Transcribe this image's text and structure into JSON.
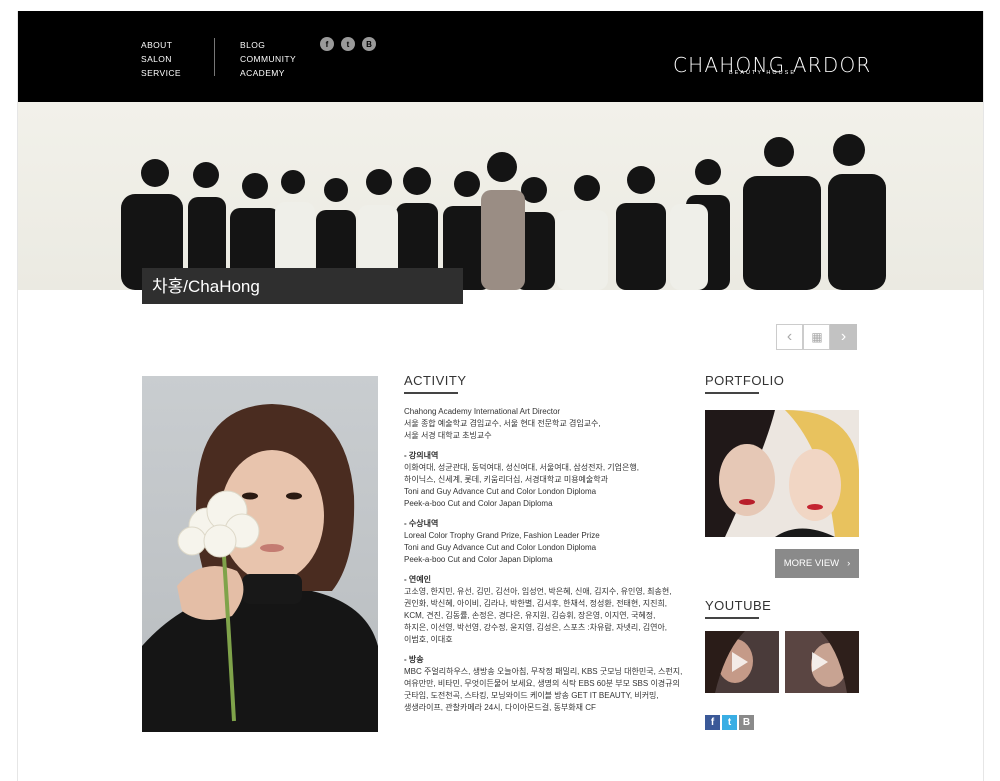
{
  "header": {
    "nav_left": [
      "ABOUT",
      "SALON",
      "SERVICE"
    ],
    "nav_right": [
      "BLOG",
      "COMMUNITY",
      "ACADEMY"
    ],
    "social": [
      {
        "icon": "facebook-icon",
        "glyph": "f"
      },
      {
        "icon": "twitter-icon",
        "glyph": "t"
      },
      {
        "icon": "blog-icon",
        "glyph": "B"
      }
    ],
    "brand": "CHAHONG ARDOR",
    "brand_sub": "BEAUTY HOUSE"
  },
  "banner": {
    "title": "차홍/ChaHong"
  },
  "pager": {
    "prev": "‹",
    "grid": "▦",
    "next": "›"
  },
  "activity": {
    "title": "ACTIVITY",
    "intro": "Chahong Academy International Art Director\n서울 종합 예술학교 겸임교수, 서울 현대 전문학교 겸임교수,\n서울 서경 대학교 초빙교수",
    "sections": [
      {
        "heading": "- 강의내역",
        "body": "이화여대, 성균관대, 동덕여대, 성신여대, 서울여대, 삼성전자, 기업은행,\n하이닉스, 신세계, 롯데, 키움리더십, 서경대학교 미용예술학과\nToni and Guy Advance Cut and Color London Diploma\nPeek-a-boo Cut and Color Japan Diploma"
      },
      {
        "heading": "- 수상내역",
        "body": "Loreal Color Trophy Grand Prize, Fashion Leader Prize\nToni and Guy Advance Cut and Color London Diploma\nPeek-a-boo Cut and Color Japan Diploma"
      },
      {
        "heading": "- 연예인",
        "body": "고소영, 한지민, 유선, 김민, 김선아, 임성언, 박은혜, 신애, 김지수, 유인영, 최송현,\n권인화, 박신혜, 아이비, 김라나, 박한별, 김서후, 한채석, 정성환, 전태현, 지진희,\nKCM, 견진, 김동률, 손정은, 경다은, 유지원, 김승휘, 장은영, 이지연, 국혜정,\n하지은, 이선영, 박선영, 강수정, 윤지영, 김성은, 스포츠 :차유람, 자넷리, 김연아,\n이범호, 이대호"
      },
      {
        "heading": "- 방송",
        "body": "MBC 주얼리하우스, 생방송 오늘아침, 무작정 패밀리, KBS 굿모닝 대한민국, 스펀지,\n여유만만, 비타민, 무엇이든물어 보세요, 생명의 식탁 EBS 60분 부모 SBS 이경규의\n굿타임, 도전천곡, 스타킹, 모닝와이드 케이블 방송 GET IT BEAUTY, 비커밍,\n생생라이프, 관찰카메라 24시, 다이아몬드걸, 동부화재 CF"
      }
    ]
  },
  "portfolio": {
    "title": "PORTFOLIO",
    "more_label": "MORE VIEW",
    "more_arrow": "›"
  },
  "youtube": {
    "title": "YOUTUBE"
  },
  "share": [
    {
      "icon": "facebook-share-icon",
      "glyph": "f",
      "color": "#3b5998"
    },
    {
      "icon": "twitter-share-icon",
      "glyph": "t",
      "color": "#3aaee4"
    },
    {
      "icon": "blog-share-icon",
      "glyph": "B",
      "color": "#8a8a8a"
    }
  ]
}
